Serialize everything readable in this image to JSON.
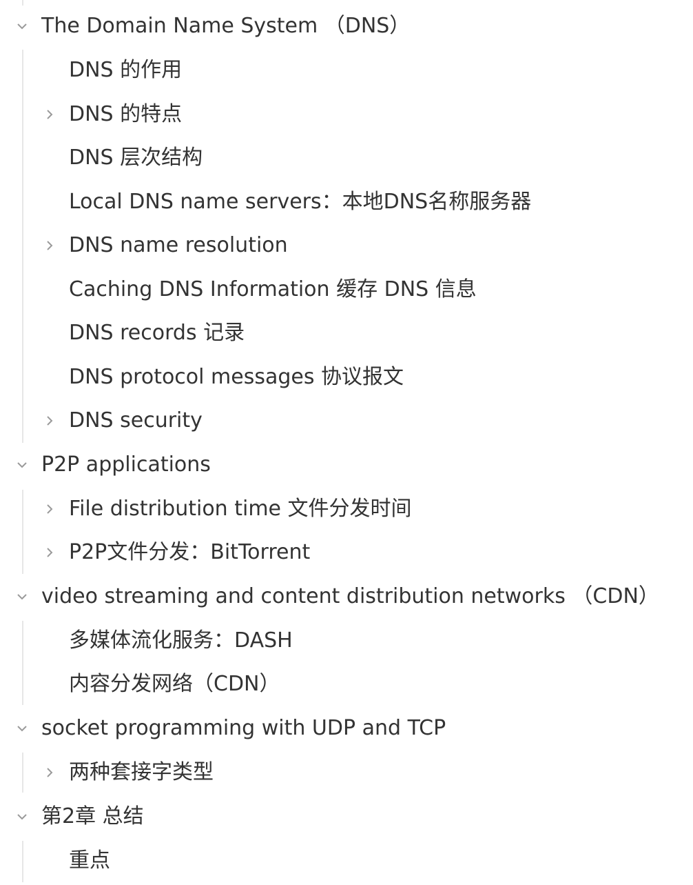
{
  "outline": [
    {
      "label": "The Domain Name System （DNS）",
      "expanded": true,
      "children": [
        {
          "label": "DNS 的作用",
          "has_children": false
        },
        {
          "label": "DNS 的特点",
          "has_children": true
        },
        {
          "label": "DNS 层次结构",
          "has_children": false
        },
        {
          "label": "Local DNS name servers：本地DNS名称服务器",
          "has_children": false
        },
        {
          "label": "DNS name resolution",
          "has_children": true
        },
        {
          "label": "Caching DNS Information 缓存 DNS 信息",
          "has_children": false
        },
        {
          "label": "DNS records 记录",
          "has_children": false
        },
        {
          "label": "DNS protocol messages 协议报文",
          "has_children": false
        },
        {
          "label": "DNS security",
          "has_children": true
        }
      ]
    },
    {
      "label": "P2P applications",
      "expanded": true,
      "children": [
        {
          "label": "File distribution time 文件分发时间",
          "has_children": true
        },
        {
          "label": "P2P文件分发：BitTorrent",
          "has_children": true
        }
      ]
    },
    {
      "label": "video streaming and content distribution networks （CDN）",
      "expanded": true,
      "children": [
        {
          "label": "多媒体流化服务：DASH",
          "has_children": false
        },
        {
          "label": "内容分发网络（CDN）",
          "has_children": false
        }
      ]
    },
    {
      "label": "socket programming with UDP and TCP",
      "expanded": true,
      "children": [
        {
          "label": "两种套接字类型",
          "has_children": true
        }
      ]
    },
    {
      "label": "第2章 总结",
      "expanded": true,
      "children": [
        {
          "label": "重点",
          "has_children": false
        }
      ]
    }
  ]
}
